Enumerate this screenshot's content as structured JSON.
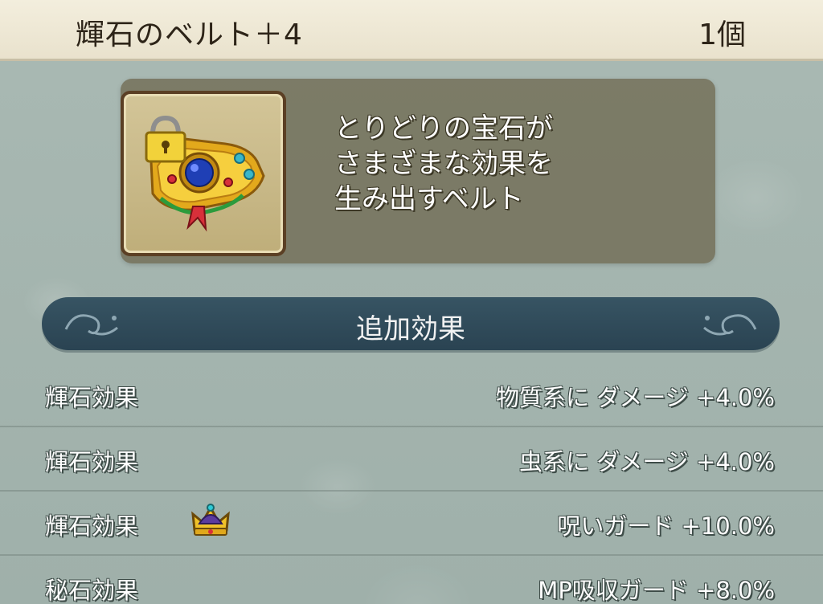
{
  "header": {
    "item_name": "輝石のベルト＋4",
    "count": "1個"
  },
  "item": {
    "icon": "jeweled-belt-icon",
    "lock_icon": "lock-icon",
    "description": [
      "とりどりの宝石が",
      "さまざまな効果を",
      "生み出すベルト"
    ]
  },
  "section": {
    "title": "追加効果"
  },
  "effects": [
    {
      "label": "輝石効果",
      "value": "物質系に ダメージ +4.0%",
      "badge": null
    },
    {
      "label": "輝石効果",
      "value": "虫系に ダメージ +4.0%",
      "badge": null
    },
    {
      "label": "輝石効果",
      "value": "呪いガード +10.0%",
      "badge": "crown-icon"
    },
    {
      "label": "秘石効果",
      "value": "MP吸収ガード +8.0%",
      "badge": null
    }
  ],
  "colors": {
    "header_bg": "#f3eedd",
    "banner_bg": "#2f4a59",
    "desc_box_bg": "#706c54",
    "text_light": "#ffffff",
    "text_dark": "#2d2418"
  }
}
